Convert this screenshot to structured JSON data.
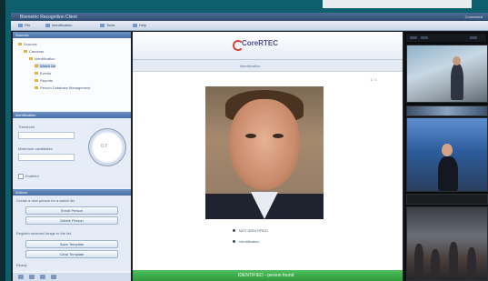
{
  "app": {
    "window_title": "Biometric Recognition Client",
    "window_status": "Connected"
  },
  "toolbar": {
    "items": [
      "File",
      "Identification",
      "Tools",
      "Help"
    ]
  },
  "left_panel": {
    "tree_header": "Sources",
    "tree_items": [
      "Sources",
      "Cameras",
      "Identification",
      "Watch list",
      "Events",
      "Reports",
      "Person Database Management"
    ],
    "ident_header": "Identification",
    "threshold_label": "Threshold",
    "dial_value": "0.7",
    "max_results_label": "Maximum candidates",
    "enabled_label": "Enabled",
    "actions_header": "Actions",
    "action_hint_1": "Create a new person for a watch list",
    "action_button_1": "Enroll Person",
    "action_button_2": "Delete Person",
    "action_hint_2": "Register selected image to the list",
    "action_button_3": "Save Template",
    "action_button_4": "Clear Template",
    "bottom_hint": "Ready"
  },
  "center": {
    "logo_text": "CoreRTEC",
    "logo_tagline": "",
    "subtitle": "Identification",
    "pager": "1 / 1",
    "status_1": "NOT IDENTIFIED",
    "status_2": "Identification",
    "result_banner": "IDENTIFIED - person found"
  },
  "videos": {
    "count": 3
  }
}
